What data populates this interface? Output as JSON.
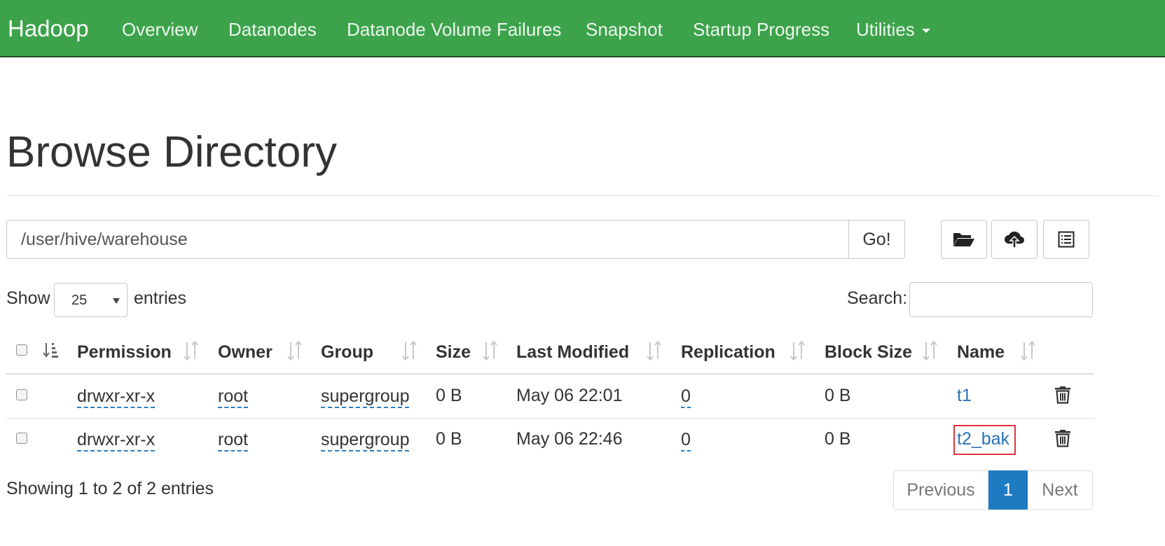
{
  "navbar": {
    "brand": "Hadoop",
    "items": [
      "Overview",
      "Datanodes",
      "Datanode Volume Failures",
      "Snapshot",
      "Startup Progress",
      "Utilities"
    ],
    "bg_color": "#3ca34b"
  },
  "page": {
    "title": "Browse Directory"
  },
  "path_bar": {
    "value": "/user/hive/warehouse",
    "go_label": "Go!"
  },
  "toolbar_icons": [
    "folder-open-icon",
    "cloud-upload-icon",
    "list-icon"
  ],
  "table_controls": {
    "show_label": "Show",
    "page_length": "25",
    "entries_label": "entries",
    "search_label": "Search:"
  },
  "table": {
    "columns": [
      "Permission",
      "Owner",
      "Group",
      "Size",
      "Last Modified",
      "Replication",
      "Block Size",
      "Name"
    ],
    "rows": [
      {
        "permission": "drwxr-xr-x",
        "owner": "root",
        "group": "supergroup",
        "size": "0 B",
        "last_modified": "May 06 22:01",
        "replication": "0",
        "block_size": "0 B",
        "name": "t1",
        "highlighted": false
      },
      {
        "permission": "drwxr-xr-x",
        "owner": "root",
        "group": "supergroup",
        "size": "0 B",
        "last_modified": "May 06 22:46",
        "replication": "0",
        "block_size": "0 B",
        "name": "t2_bak",
        "highlighted": true
      }
    ]
  },
  "footer": {
    "info": "Showing 1 to 2 of 2 entries",
    "pagination": {
      "previous": "Previous",
      "current": "1",
      "next": "Next"
    }
  },
  "colors": {
    "link": "#2a72b5",
    "active_page": "#1e7bc1",
    "highlight_border": "#e0343b"
  }
}
